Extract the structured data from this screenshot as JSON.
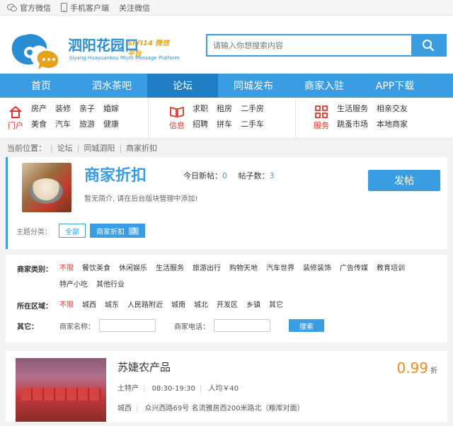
{
  "topbar": {
    "items": [
      {
        "label": "官方微信",
        "icon": "wechat-icon"
      },
      {
        "label": "手机客户端",
        "icon": "phone-icon"
      },
      {
        "label": "关注微信",
        "icon": "follow-icon"
      }
    ]
  },
  "header": {
    "logo_text": "泗阳花园口",
    "logo_tag": "SIYI14 微信平台",
    "logo_sub": "Siyang Huayuankou Micro Message Platform",
    "search_placeholder": "请输入你想搜索内容"
  },
  "nav": {
    "items": [
      "首页",
      "泗水茶吧",
      "论坛",
      "同城发布",
      "商家入驻",
      "APP下载"
    ],
    "active_index": 2
  },
  "subnav": {
    "groups": [
      {
        "title": "门户",
        "icon": "home-icon",
        "links": [
          "房产",
          "美食",
          "装修",
          "汽车",
          "亲子",
          "旅游",
          "婚嫁",
          "健康"
        ]
      },
      {
        "title": "信息",
        "icon": "book-icon",
        "links": [
          "求职",
          "招聘",
          "租房",
          "拼车",
          "二手房",
          "二手车"
        ]
      },
      {
        "title": "服务",
        "icon": "grid-icon",
        "links": [
          "生活服务",
          "跳蚤市场",
          "相亲交友",
          "本地商家"
        ]
      }
    ]
  },
  "breadcrumb": {
    "label": "当前位置：",
    "items": [
      "论坛",
      "同城泗阳",
      "商家折扣"
    ]
  },
  "forum": {
    "title": "商家折扣",
    "today_label": "今日新帖：",
    "today_value": "0",
    "posts_label": "帖子数：",
    "posts_value": "3",
    "desc": "暂无简介, 请在后台版块管理中添加!",
    "post_button": "发帖",
    "topics_label": "主题分类：",
    "topic_all": "全部",
    "topic_current": "商家折扣",
    "topic_current_count": "3"
  },
  "filter": {
    "category_label": "商家类别：",
    "categories": [
      "不限",
      "餐饮美食",
      "休闲娱乐",
      "生活服务",
      "旅游出行",
      "购物天地",
      "汽车世界",
      "装修装饰",
      "广告传媒",
      "教育培训",
      "特产小吃",
      "其他行业"
    ],
    "area_label": "所在区域：",
    "areas": [
      "不限",
      "城西",
      "城东",
      "人民路附近",
      "城南",
      "城北",
      "开发区",
      "乡镇",
      "其它"
    ],
    "other_label": "其它：",
    "name_label": "商家名称：",
    "phone_label": "商家电话：",
    "search_button": "搜索"
  },
  "listing": {
    "name": "苏婕农产品",
    "category": "土特产",
    "hours": "08:30-19:30",
    "avg_price": "人均￥40",
    "area": "城西",
    "address": "众兴西路69号 名流雅居西200米路北（粮库对面）",
    "discount": "0.99",
    "discount_unit": "折"
  },
  "colors": {
    "accent": "#3a9de1",
    "nav_active": "#1f7ec4",
    "highlight": "#e0342c",
    "price": "#f08a24"
  }
}
